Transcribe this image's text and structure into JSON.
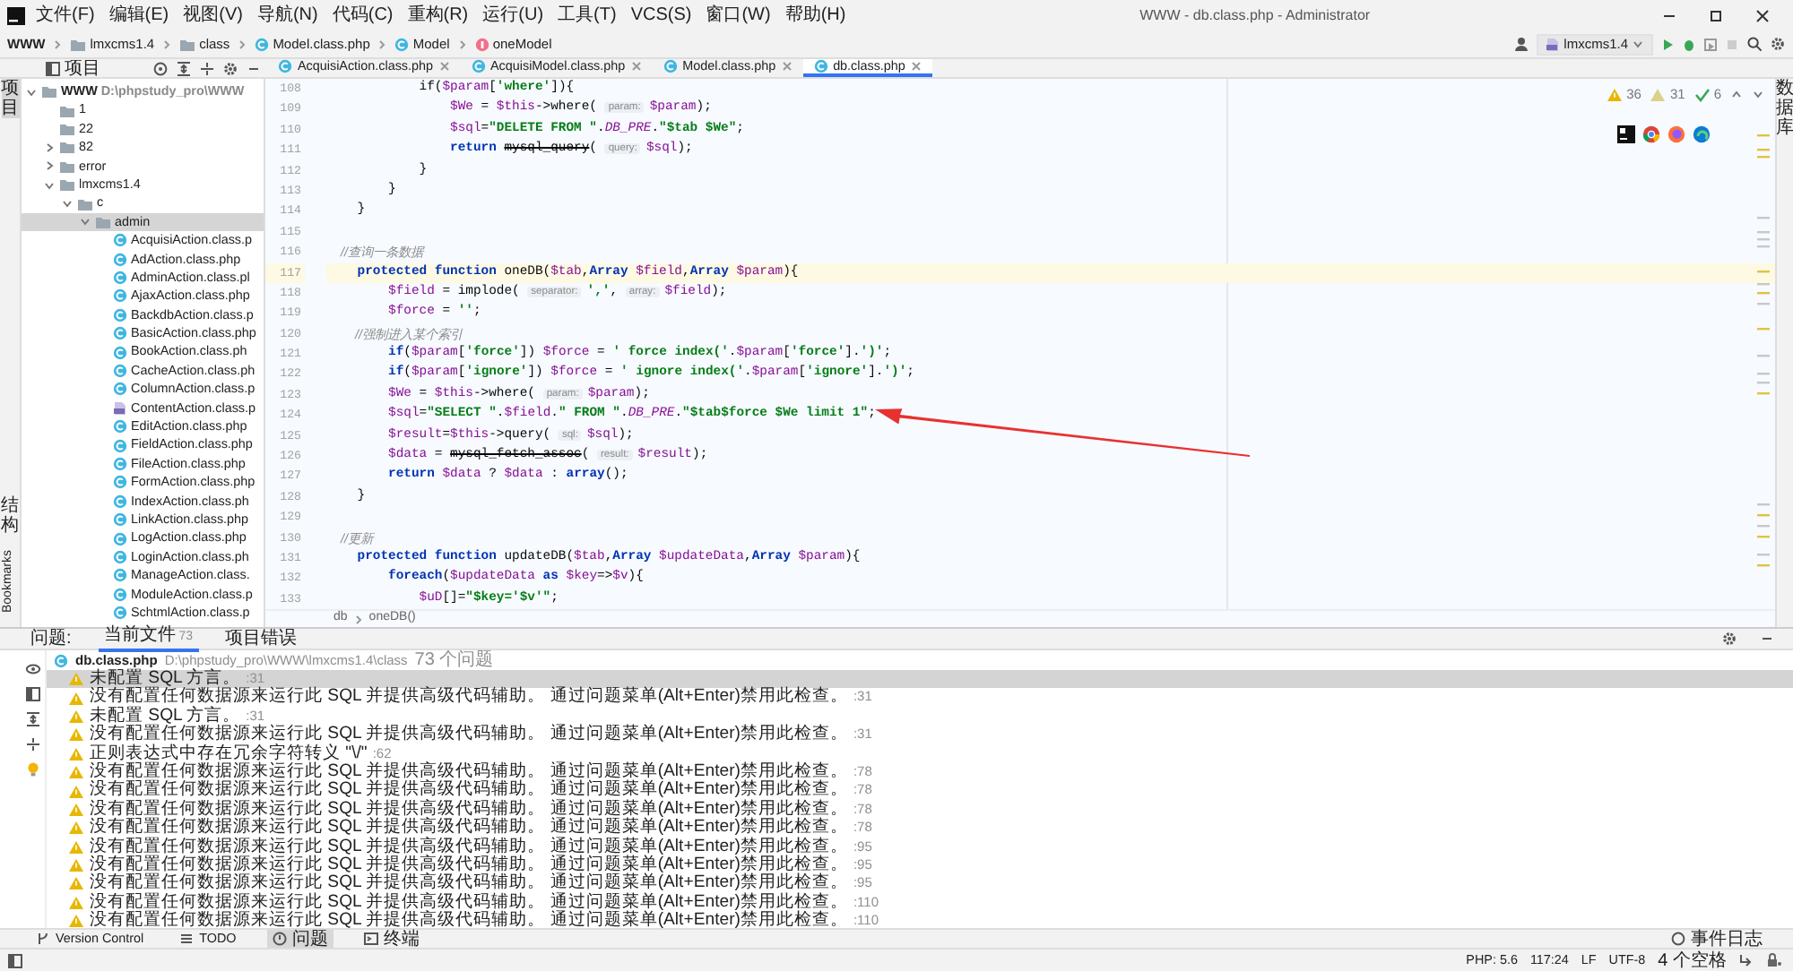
{
  "title_bar": {
    "menus": [
      "文件(F)",
      "编辑(E)",
      "视图(V)",
      "导航(N)",
      "代码(C)",
      "重构(R)",
      "运行(U)",
      "工具(T)",
      "VCS(S)",
      "窗口(W)",
      "帮助(H)"
    ],
    "title": "WWW - db.class.php - Administrator"
  },
  "nav_bar": {
    "crumbs": [
      {
        "label": "WWW",
        "kind": "root"
      },
      {
        "label": "lmxcms1.4",
        "kind": "folder"
      },
      {
        "label": "class",
        "kind": "folder"
      },
      {
        "label": "Model.class.php",
        "kind": "php-class"
      },
      {
        "label": "Model",
        "kind": "class"
      },
      {
        "label": "oneModel",
        "kind": "method"
      }
    ],
    "run_config": "lmxcms1.4"
  },
  "left_strip": {
    "top": "项目",
    "bottom": [
      "结构",
      "Bookmarks"
    ]
  },
  "right_strip": {
    "label": "数据库"
  },
  "project": {
    "title": "项目",
    "tree": [
      {
        "label": "WWW",
        "path": "D:\\phpstudy_pro\\WWW",
        "kind": "folder",
        "expanded": true,
        "selected": false,
        "children": [
          {
            "label": "1",
            "kind": "plain-folder",
            "selected": false
          },
          {
            "label": "22",
            "kind": "plain-folder",
            "selected": false
          },
          {
            "label": "82",
            "kind": "folder",
            "expanded": false,
            "selected": false
          },
          {
            "label": "error",
            "kind": "folder",
            "expanded": false,
            "selected": false
          },
          {
            "label": "lmxcms1.4",
            "kind": "folder",
            "expanded": true,
            "selected": false,
            "children": [
              {
                "label": "c",
                "kind": "folder",
                "expanded": true,
                "selected": false,
                "children": [
                  {
                    "label": "admin",
                    "kind": "folder",
                    "expanded": true,
                    "selected": true,
                    "children": [
                      {
                        "label": "AcquisiAction.class.p",
                        "kind": "php-class",
                        "selected": false
                      },
                      {
                        "label": "AdAction.class.php",
                        "kind": "php-class",
                        "selected": false
                      },
                      {
                        "label": "AdminAction.class.pl",
                        "kind": "php-class",
                        "selected": false
                      },
                      {
                        "label": "AjaxAction.class.php",
                        "kind": "php-class",
                        "selected": false
                      },
                      {
                        "label": "BackdbAction.class.p",
                        "kind": "php-class",
                        "selected": false
                      },
                      {
                        "label": "BasicAction.class.php",
                        "kind": "php-class",
                        "selected": false
                      },
                      {
                        "label": "BookAction.class.ph",
                        "kind": "php-class",
                        "selected": false
                      },
                      {
                        "label": "CacheAction.class.ph",
                        "kind": "php-class",
                        "selected": false
                      },
                      {
                        "label": "ColumnAction.class.p",
                        "kind": "php-class",
                        "selected": false
                      },
                      {
                        "label": "ContentAction.class.p",
                        "kind": "php-file",
                        "selected": false
                      },
                      {
                        "label": "EditAction.class.php",
                        "kind": "php-class",
                        "selected": false
                      },
                      {
                        "label": "FieldAction.class.php",
                        "kind": "php-class",
                        "selected": false
                      },
                      {
                        "label": "FileAction.class.php",
                        "kind": "php-class",
                        "selected": false
                      },
                      {
                        "label": "FormAction.class.php",
                        "kind": "php-class",
                        "selected": false
                      },
                      {
                        "label": "IndexAction.class.ph",
                        "kind": "php-class",
                        "selected": false
                      },
                      {
                        "label": "LinkAction.class.php",
                        "kind": "php-class",
                        "selected": false
                      },
                      {
                        "label": "LogAction.class.php",
                        "kind": "php-class",
                        "selected": false
                      },
                      {
                        "label": "LoginAction.class.ph",
                        "kind": "php-class",
                        "selected": false
                      },
                      {
                        "label": "ManageAction.class.",
                        "kind": "php-class",
                        "selected": false
                      },
                      {
                        "label": "ModuleAction.class.p",
                        "kind": "php-class",
                        "selected": false
                      },
                      {
                        "label": "SchtmlAction.class.p",
                        "kind": "php-class",
                        "selected": false
                      }
                    ]
                  }
                ]
              }
            ]
          }
        ]
      }
    ]
  },
  "editor_tabs": [
    {
      "label": "AcquisiAction.class.php",
      "selected": false
    },
    {
      "label": "AcquisiModel.class.php",
      "selected": false
    },
    {
      "label": "Model.class.php",
      "selected": false
    },
    {
      "label": "db.class.php",
      "selected": true
    }
  ],
  "editor": {
    "inspections": [
      {
        "kind": "warning",
        "count": "36"
      },
      {
        "kind": "weak-warning",
        "count": "31"
      },
      {
        "kind": "typo",
        "count": "6"
      }
    ],
    "lines": [
      {
        "number": "108",
        "current": false,
        "segments": [
          {
            "kind": "txt",
            "text": "            if("
          },
          {
            "kind": "var",
            "text": "$param"
          },
          {
            "kind": "txt",
            "text": "["
          },
          {
            "kind": "str",
            "text": "'where'"
          },
          {
            "kind": "txt",
            "text": "]){"
          }
        ]
      },
      {
        "number": "109",
        "current": false,
        "segments": [
          {
            "kind": "var",
            "text": "                $We"
          },
          {
            "kind": "txt",
            "text": " = "
          },
          {
            "kind": "var",
            "text": "$this"
          },
          {
            "kind": "txt",
            "text": "->where( "
          },
          {
            "kind": "hint",
            "text": "param:"
          },
          {
            "kind": "var",
            "text": "$param"
          },
          {
            "kind": "txt",
            "text": ");"
          }
        ]
      },
      {
        "number": "110",
        "current": false,
        "segments": [
          {
            "kind": "var",
            "text": "                $sql"
          },
          {
            "kind": "txt",
            "text": "="
          },
          {
            "kind": "str",
            "text": "\"DELETE FROM \""
          },
          {
            "kind": "txt",
            "text": "."
          },
          {
            "kind": "const",
            "text": "DB_PRE"
          },
          {
            "kind": "txt",
            "text": "."
          },
          {
            "kind": "str",
            "text": "\"$tab $We\""
          },
          {
            "kind": "txt",
            "text": ";"
          }
        ]
      },
      {
        "number": "111",
        "current": false,
        "segments": [
          {
            "kind": "kw",
            "text": "                return "
          },
          {
            "kind": "depr",
            "text": "mysql_query"
          },
          {
            "kind": "txt",
            "text": "( "
          },
          {
            "kind": "hint",
            "text": "query:"
          },
          {
            "kind": "var",
            "text": "$sql"
          },
          {
            "kind": "txt",
            "text": ");"
          }
        ]
      },
      {
        "number": "112",
        "current": false,
        "segments": [
          {
            "kind": "txt",
            "text": "            }"
          }
        ]
      },
      {
        "number": "113",
        "current": false,
        "segments": [
          {
            "kind": "txt",
            "text": "        }"
          }
        ]
      },
      {
        "number": "114",
        "current": false,
        "segments": [
          {
            "kind": "txt",
            "text": "    }"
          }
        ]
      },
      {
        "number": "115",
        "current": false
      },
      {
        "number": "116",
        "current": false,
        "segments": [
          {
            "kind": "cmt",
            "text": "    //查询一条数据"
          }
        ]
      },
      {
        "number": "117",
        "current": true,
        "segments": [
          {
            "kind": "kw",
            "text": "    protected function "
          },
          {
            "kind": "txt",
            "text": "oneDB("
          },
          {
            "kind": "var",
            "text": "$tab"
          },
          {
            "kind": "txt",
            "text": ","
          },
          {
            "kind": "kw",
            "text": "Array "
          },
          {
            "kind": "var",
            "text": "$field"
          },
          {
            "kind": "txt",
            "text": ","
          },
          {
            "kind": "kw",
            "text": "Array "
          },
          {
            "kind": "var",
            "text": "$param"
          },
          {
            "kind": "txt",
            "text": "){"
          }
        ]
      },
      {
        "number": "118",
        "current": false,
        "segments": [
          {
            "kind": "var",
            "text": "        $field"
          },
          {
            "kind": "txt",
            "text": " = implode( "
          },
          {
            "kind": "hint",
            "text": "separator:"
          },
          {
            "kind": "str",
            "text": "','"
          },
          {
            "kind": "txt",
            "text": ", "
          },
          {
            "kind": "hint",
            "text": "array:"
          },
          {
            "kind": "var",
            "text": "$field"
          },
          {
            "kind": "txt",
            "text": ");"
          }
        ]
      },
      {
        "number": "119",
        "current": false,
        "segments": [
          {
            "kind": "var",
            "text": "        $force"
          },
          {
            "kind": "txt",
            "text": " = "
          },
          {
            "kind": "str",
            "text": "''"
          },
          {
            "kind": "txt",
            "text": ";"
          }
        ]
      },
      {
        "number": "120",
        "current": false,
        "segments": [
          {
            "kind": "cmt",
            "text": "        //强制进入某个索引"
          }
        ]
      },
      {
        "number": "121",
        "current": false,
        "segments": [
          {
            "kind": "kw",
            "text": "        if"
          },
          {
            "kind": "txt",
            "text": "("
          },
          {
            "kind": "var",
            "text": "$param"
          },
          {
            "kind": "txt",
            "text": "["
          },
          {
            "kind": "str",
            "text": "'force'"
          },
          {
            "kind": "txt",
            "text": "]) "
          },
          {
            "kind": "var",
            "text": "$force"
          },
          {
            "kind": "txt",
            "text": " = "
          },
          {
            "kind": "str",
            "text": "' force index('"
          },
          {
            "kind": "txt",
            "text": "."
          },
          {
            "kind": "var",
            "text": "$param"
          },
          {
            "kind": "txt",
            "text": "["
          },
          {
            "kind": "str",
            "text": "'force'"
          },
          {
            "kind": "txt",
            "text": "]."
          },
          {
            "kind": "str",
            "text": "')'"
          },
          {
            "kind": "txt",
            "text": ";"
          }
        ]
      },
      {
        "number": "122",
        "current": false,
        "segments": [
          {
            "kind": "kw",
            "text": "        if"
          },
          {
            "kind": "txt",
            "text": "("
          },
          {
            "kind": "var",
            "text": "$param"
          },
          {
            "kind": "txt",
            "text": "["
          },
          {
            "kind": "str",
            "text": "'ignore'"
          },
          {
            "kind": "txt",
            "text": "]) "
          },
          {
            "kind": "var",
            "text": "$force"
          },
          {
            "kind": "txt",
            "text": " = "
          },
          {
            "kind": "str",
            "text": "' ignore index('"
          },
          {
            "kind": "txt",
            "text": "."
          },
          {
            "kind": "var",
            "text": "$param"
          },
          {
            "kind": "txt",
            "text": "["
          },
          {
            "kind": "str",
            "text": "'ignore'"
          },
          {
            "kind": "txt",
            "text": "]."
          },
          {
            "kind": "str",
            "text": "')'"
          },
          {
            "kind": "txt",
            "text": ";"
          }
        ]
      },
      {
        "number": "123",
        "current": false,
        "segments": [
          {
            "kind": "var",
            "text": "        $We"
          },
          {
            "kind": "txt",
            "text": " = "
          },
          {
            "kind": "var",
            "text": "$this"
          },
          {
            "kind": "txt",
            "text": "->where( "
          },
          {
            "kind": "hint",
            "text": "param:"
          },
          {
            "kind": "var",
            "text": "$param"
          },
          {
            "kind": "txt",
            "text": ");"
          }
        ]
      },
      {
        "number": "124",
        "current": false,
        "segments": [
          {
            "kind": "var",
            "text": "        $sql"
          },
          {
            "kind": "txt",
            "text": "="
          },
          {
            "kind": "str",
            "text": "\"SELECT \""
          },
          {
            "kind": "txt",
            "text": "."
          },
          {
            "kind": "var",
            "text": "$field"
          },
          {
            "kind": "txt",
            "text": "."
          },
          {
            "kind": "str",
            "text": "\" FROM \""
          },
          {
            "kind": "txt",
            "text": "."
          },
          {
            "kind": "const",
            "text": "DB_PRE"
          },
          {
            "kind": "txt",
            "text": "."
          },
          {
            "kind": "str",
            "text": "\"$tab$force $We limit 1\""
          },
          {
            "kind": "txt",
            "text": ";"
          }
        ]
      },
      {
        "number": "125",
        "current": false,
        "segments": [
          {
            "kind": "var",
            "text": "        $result"
          },
          {
            "kind": "txt",
            "text": "="
          },
          {
            "kind": "var",
            "text": "$this"
          },
          {
            "kind": "txt",
            "text": "->query( "
          },
          {
            "kind": "hint",
            "text": "sql:"
          },
          {
            "kind": "var",
            "text": "$sql"
          },
          {
            "kind": "txt",
            "text": ");"
          }
        ]
      },
      {
        "number": "126",
        "current": false,
        "segments": [
          {
            "kind": "var",
            "text": "        $data"
          },
          {
            "kind": "txt",
            "text": " = "
          },
          {
            "kind": "depr",
            "text": "mysql_fetch_assoc"
          },
          {
            "kind": "txt",
            "text": "( "
          },
          {
            "kind": "hint",
            "text": "result:"
          },
          {
            "kind": "var",
            "text": "$result"
          },
          {
            "kind": "txt",
            "text": ");"
          }
        ]
      },
      {
        "number": "127",
        "current": false,
        "segments": [
          {
            "kind": "kw",
            "text": "        return "
          },
          {
            "kind": "var",
            "text": "$data"
          },
          {
            "kind": "txt",
            "text": " ? "
          },
          {
            "kind": "var",
            "text": "$data"
          },
          {
            "kind": "txt",
            "text": " : "
          },
          {
            "kind": "kw",
            "text": "array"
          },
          {
            "kind": "txt",
            "text": "();"
          }
        ]
      },
      {
        "number": "128",
        "current": false,
        "segments": [
          {
            "kind": "txt",
            "text": "    }"
          }
        ]
      },
      {
        "number": "129",
        "current": false
      },
      {
        "number": "130",
        "current": false,
        "segments": [
          {
            "kind": "cmt",
            "text": "    //更新"
          }
        ]
      },
      {
        "number": "131",
        "current": false,
        "segments": [
          {
            "kind": "kw",
            "text": "    protected function "
          },
          {
            "kind": "txt",
            "text": "updateDB("
          },
          {
            "kind": "var",
            "text": "$tab"
          },
          {
            "kind": "txt",
            "text": ","
          },
          {
            "kind": "kw",
            "text": "Array "
          },
          {
            "kind": "var",
            "text": "$updateData"
          },
          {
            "kind": "txt",
            "text": ","
          },
          {
            "kind": "kw",
            "text": "Array "
          },
          {
            "kind": "var",
            "text": "$param"
          },
          {
            "kind": "txt",
            "text": "){"
          }
        ]
      },
      {
        "number": "132",
        "current": false,
        "segments": [
          {
            "kind": "kw",
            "text": "        foreach"
          },
          {
            "kind": "txt",
            "text": "("
          },
          {
            "kind": "var",
            "text": "$updateData"
          },
          {
            "kind": "kw",
            "text": " as "
          },
          {
            "kind": "var",
            "text": "$key"
          },
          {
            "kind": "txt",
            "text": "=>"
          },
          {
            "kind": "var",
            "text": "$v"
          },
          {
            "kind": "txt",
            "text": "){"
          }
        ]
      },
      {
        "number": "133",
        "current": false,
        "segments": [
          {
            "kind": "var",
            "text": "            $uD"
          },
          {
            "kind": "txt",
            "text": "[]="
          },
          {
            "kind": "str",
            "text": "\"$key='$v'\""
          },
          {
            "kind": "txt",
            "text": ";"
          }
        ]
      }
    ],
    "breadcrumb": [
      "db",
      "oneDB()"
    ],
    "annotation": {
      "kind": "arrow"
    }
  },
  "problems": {
    "caption": "问题:",
    "tabs": [
      {
        "label": "当前文件",
        "count": "73",
        "selected": true
      },
      {
        "label": "项目错误",
        "selected": false
      }
    ],
    "file": {
      "name": "db.class.php",
      "path": "D:\\phpstudy_pro\\WWW\\lmxcms1.4\\class",
      "count": "73 个问题"
    },
    "rows": [
      {
        "message": "未配置 SQL 方言。",
        "line": ":31",
        "selected": true
      },
      {
        "message": "没有配置任何数据源来运行此 SQL 并提供高级代码辅助。 通过问题菜单(Alt+Enter)禁用此检查。",
        "line": ":31",
        "selected": false
      },
      {
        "message": "未配置 SQL 方言。",
        "line": ":31",
        "selected": false
      },
      {
        "message": "没有配置任何数据源来运行此 SQL 并提供高级代码辅助。 通过问题菜单(Alt+Enter)禁用此检查。",
        "line": ":31",
        "selected": false
      },
      {
        "message": "正则表达式中存在冗余字符转义 \"\\/\"",
        "line": ":62",
        "selected": false
      },
      {
        "message": "没有配置任何数据源来运行此 SQL 并提供高级代码辅助。 通过问题菜单(Alt+Enter)禁用此检查。",
        "line": ":78",
        "selected": false
      },
      {
        "message": "没有配置任何数据源来运行此 SQL 并提供高级代码辅助。 通过问题菜单(Alt+Enter)禁用此检查。",
        "line": ":78",
        "selected": false
      },
      {
        "message": "没有配置任何数据源来运行此 SQL 并提供高级代码辅助。 通过问题菜单(Alt+Enter)禁用此检查。",
        "line": ":78",
        "selected": false
      },
      {
        "message": "没有配置任何数据源来运行此 SQL 并提供高级代码辅助。 通过问题菜单(Alt+Enter)禁用此检查。",
        "line": ":78",
        "selected": false
      },
      {
        "message": "没有配置任何数据源来运行此 SQL 并提供高级代码辅助。 通过问题菜单(Alt+Enter)禁用此检查。",
        "line": ":95",
        "selected": false
      },
      {
        "message": "没有配置任何数据源来运行此 SQL 并提供高级代码辅助。 通过问题菜单(Alt+Enter)禁用此检查。",
        "line": ":95",
        "selected": false
      },
      {
        "message": "没有配置任何数据源来运行此 SQL 并提供高级代码辅助。 通过问题菜单(Alt+Enter)禁用此检查。",
        "line": ":95",
        "selected": false
      },
      {
        "message": "没有配置任何数据源来运行此 SQL 并提供高级代码辅助。 通过问题菜单(Alt+Enter)禁用此检查。",
        "line": ":110",
        "selected": false
      },
      {
        "message": "没有配置任何数据源来运行此 SQL 并提供高级代码辅助。 通过问题菜单(Alt+Enter)禁用此检查。",
        "line": ":110",
        "selected": false
      }
    ]
  },
  "tool_bar": {
    "items": [
      {
        "label": "Version Control",
        "kind": "vcs",
        "selected": false
      },
      {
        "label": "TODO",
        "kind": "todo",
        "selected": false
      },
      {
        "label": "问题",
        "kind": "problems",
        "selected": true
      },
      {
        "label": "终端",
        "kind": "terminal",
        "selected": false
      }
    ],
    "event_log": "事件日志"
  },
  "status_bar": [
    "PHP: 5.6",
    "117:24",
    "LF",
    "UTF-8",
    "4 个空格"
  ]
}
